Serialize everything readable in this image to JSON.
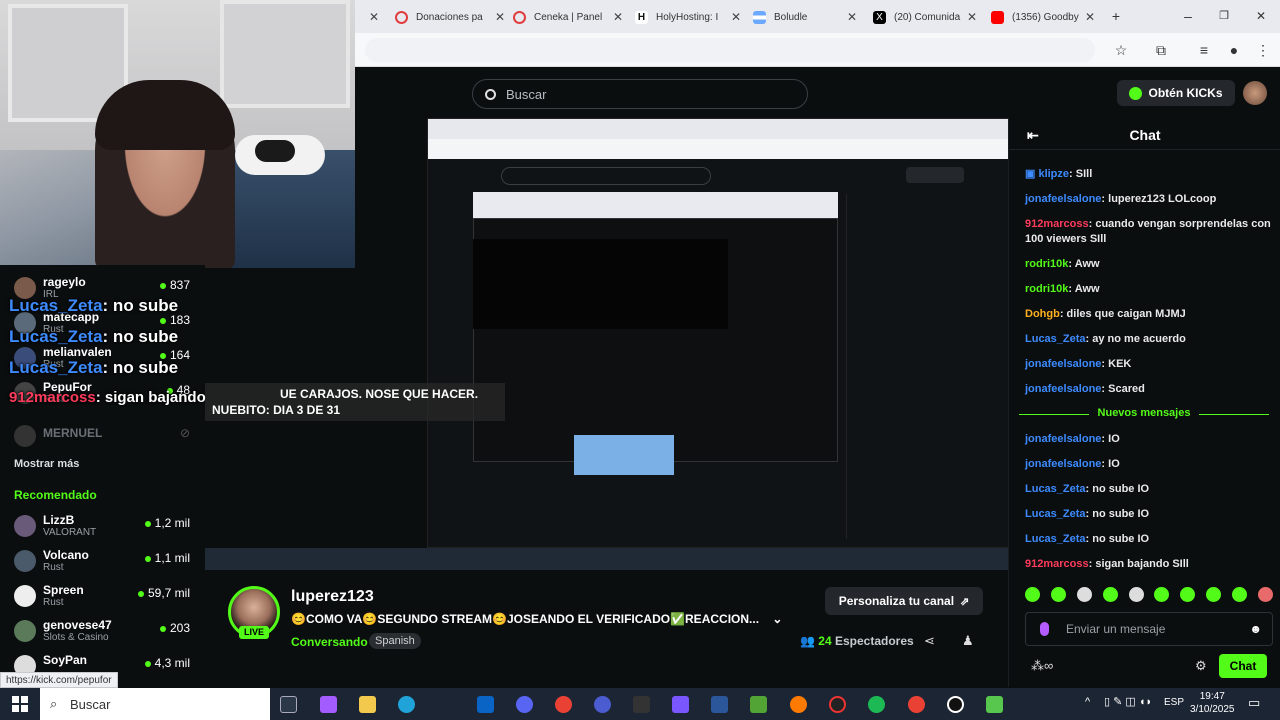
{
  "browser": {
    "tabs": [
      {
        "label": "Donaciones pa",
        "icon": "donation-icon",
        "color": "#e03e3e"
      },
      {
        "label": "Ceneka | Panel",
        "icon": "ceneka-icon",
        "color": "#e03e3e"
      },
      {
        "label": "HolyHosting: I",
        "icon": "holyhosting-icon",
        "color": "#111111"
      },
      {
        "label": "Boludle",
        "icon": "boludle-icon",
        "color": "#6aa9ff"
      },
      {
        "label": "(20) Comunida",
        "icon": "x-icon",
        "color": "#000000"
      },
      {
        "label": "(1356) Goodby",
        "icon": "youtube-icon",
        "color": "#ff0000"
      }
    ]
  },
  "kick": {
    "search_placeholder": "Buscar",
    "kicks_button": "Obtén KICKs",
    "stream": {
      "streamer": "luperez123",
      "live": "LIVE",
      "title": "😊COMO VA😊SEGUNDO STREAM😊JOSEANDO EL VERIFICADO✅REACCION...",
      "category": "Conversando",
      "language": "Spanish",
      "customize_button": "Personaliza tu canal",
      "viewers_count": "24",
      "viewers_label": "Espectadores"
    },
    "sidebar": {
      "following": [
        {
          "name": "rageylo",
          "category": "IRL",
          "count": "837"
        },
        {
          "name": "matecapp",
          "category": "Rust",
          "count": "183"
        },
        {
          "name": "melianvalen",
          "category": "Rust",
          "count": "164"
        },
        {
          "name": "PepuFor",
          "category": "Rust",
          "count": "48"
        },
        {
          "name": "MERNUEL",
          "category": "",
          "count": ""
        }
      ],
      "show_more": "Mostrar más",
      "recommended_title": "Recomendado",
      "recommended": [
        {
          "name": "LizzB",
          "category": "VALORANT",
          "count": "1,2 mil"
        },
        {
          "name": "Volcano",
          "category": "Rust",
          "count": "1,1 mil"
        },
        {
          "name": "Spreen",
          "category": "Rust",
          "count": "59,7 mil"
        },
        {
          "name": "genovese47",
          "category": "Slots & Casino",
          "count": "203"
        },
        {
          "name": "SoyPan",
          "category": "",
          "count": "4,3 mil"
        }
      ]
    },
    "overlay": {
      "line1_user": "Lucas_Zeta",
      "line1_text": ": no sube",
      "line2_user": "Lucas_Zeta",
      "line2_text": ": no sube",
      "line3_user": "Lucas_Zeta",
      "line3_text": ": no sube",
      "line4_user": "912marcoss",
      "line4_text": ": sigan bajando",
      "banner_line1": "UE CARAJOS. NOSE QUE HACER.",
      "banner_line2": "NUEBITO: DIA 3 DE 31"
    },
    "chat": {
      "title": "Chat",
      "messages": [
        {
          "user": "klipze",
          "text": ": SIll",
          "color": "#3d8bff"
        },
        {
          "user": "jonafeelsalone",
          "text": ": luperez123 LOLcoop",
          "color": "#3d8bff"
        },
        {
          "user": "912marcoss",
          "text": ": cuando vengan sorprendelas con 100 viewers SIll",
          "color": "#ff3b5c"
        },
        {
          "user": "rodri10k",
          "text": ": Aww",
          "color": "#53fc18"
        },
        {
          "user": "rodri10k",
          "text": ": Aww",
          "color": "#53fc18"
        },
        {
          "user": "Dohgb",
          "text": ": diles que caigan MJMJ",
          "color": "#ffb020"
        },
        {
          "user": "Lucas_Zeta",
          "text": ": ay no me acuerdo",
          "color": "#3d8bff"
        },
        {
          "user": "jonafeelsalone",
          "text": ": KEK",
          "color": "#3d8bff"
        },
        {
          "user": "jonafeelsalone",
          "text": ": Scared",
          "color": "#3d8bff"
        }
      ],
      "new_messages": "Nuevos mensajes",
      "new": [
        {
          "user": "jonafeelsalone",
          "text": ": IO",
          "color": "#3d8bff"
        },
        {
          "user": "jonafeelsalone",
          "text": ": IO",
          "color": "#3d8bff"
        },
        {
          "user": "Lucas_Zeta",
          "text": ": no sube IO",
          "color": "#3d8bff"
        },
        {
          "user": "Lucas_Zeta",
          "text": ": no sube IO",
          "color": "#3d8bff"
        },
        {
          "user": "Lucas_Zeta",
          "text": ": no sube IO",
          "color": "#3d8bff"
        },
        {
          "user": "912marcoss",
          "text": ": sigan bajando SIll",
          "color": "#ff3b5c"
        }
      ],
      "input_placeholder": "Enviar un mensaje",
      "send_button": "Chat"
    }
  },
  "status_url": "https://kick.com/pepufor",
  "taskbar": {
    "search_placeholder": "Buscar",
    "language": "ESP",
    "time": "19:47",
    "date": "3/10/2025"
  }
}
